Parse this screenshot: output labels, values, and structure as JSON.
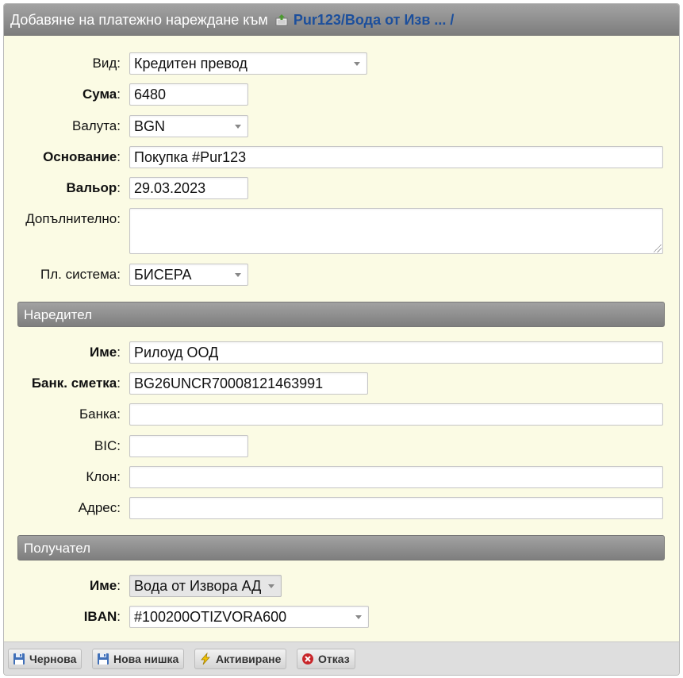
{
  "header": {
    "title_prefix": "Добавяне на платежно нареждане към",
    "title_link": "Pur123/Вода от Изв ... /"
  },
  "form": {
    "vid": {
      "label": "Вид",
      "value": "Кредитен превод"
    },
    "suma": {
      "label": "Сума",
      "value": "6480"
    },
    "valuta": {
      "label": "Валута",
      "value": "BGN"
    },
    "osnovanie": {
      "label": "Основание",
      "value": "Покупка #Pur123"
    },
    "valor": {
      "label": "Вальор",
      "value": "29.03.2023"
    },
    "dopalnitelno": {
      "label": "Допълнително",
      "value": ""
    },
    "pl_sistema": {
      "label": "Пл. система",
      "value": "БИСЕРА"
    }
  },
  "naredital": {
    "title": "Наредител",
    "ime": {
      "label": "Име",
      "value": "Рилоуд ООД"
    },
    "bank_smetka": {
      "label": "Банк. сметка",
      "value": "BG26UNCR70008121463991"
    },
    "banka": {
      "label": "Банка",
      "value": ""
    },
    "bic": {
      "label": "BIC",
      "value": ""
    },
    "klon": {
      "label": "Клон",
      "value": ""
    },
    "adres": {
      "label": "Адрес",
      "value": ""
    }
  },
  "poluchatel": {
    "title": "Получател",
    "ime": {
      "label": "Име",
      "value": "Вода от Извора АД"
    },
    "iban": {
      "label": "IBAN",
      "value": "#100200OTIZVORA600"
    }
  },
  "colon": ":",
  "footer": {
    "draft": "Чернова",
    "new_thread": "Нова нишка",
    "activate": "Активиране",
    "cancel": "Отказ"
  },
  "colors": {
    "panel_bg": "#fbfbe4",
    "title_link": "#1c4f9c",
    "header_grey": "#8e8e8e"
  }
}
